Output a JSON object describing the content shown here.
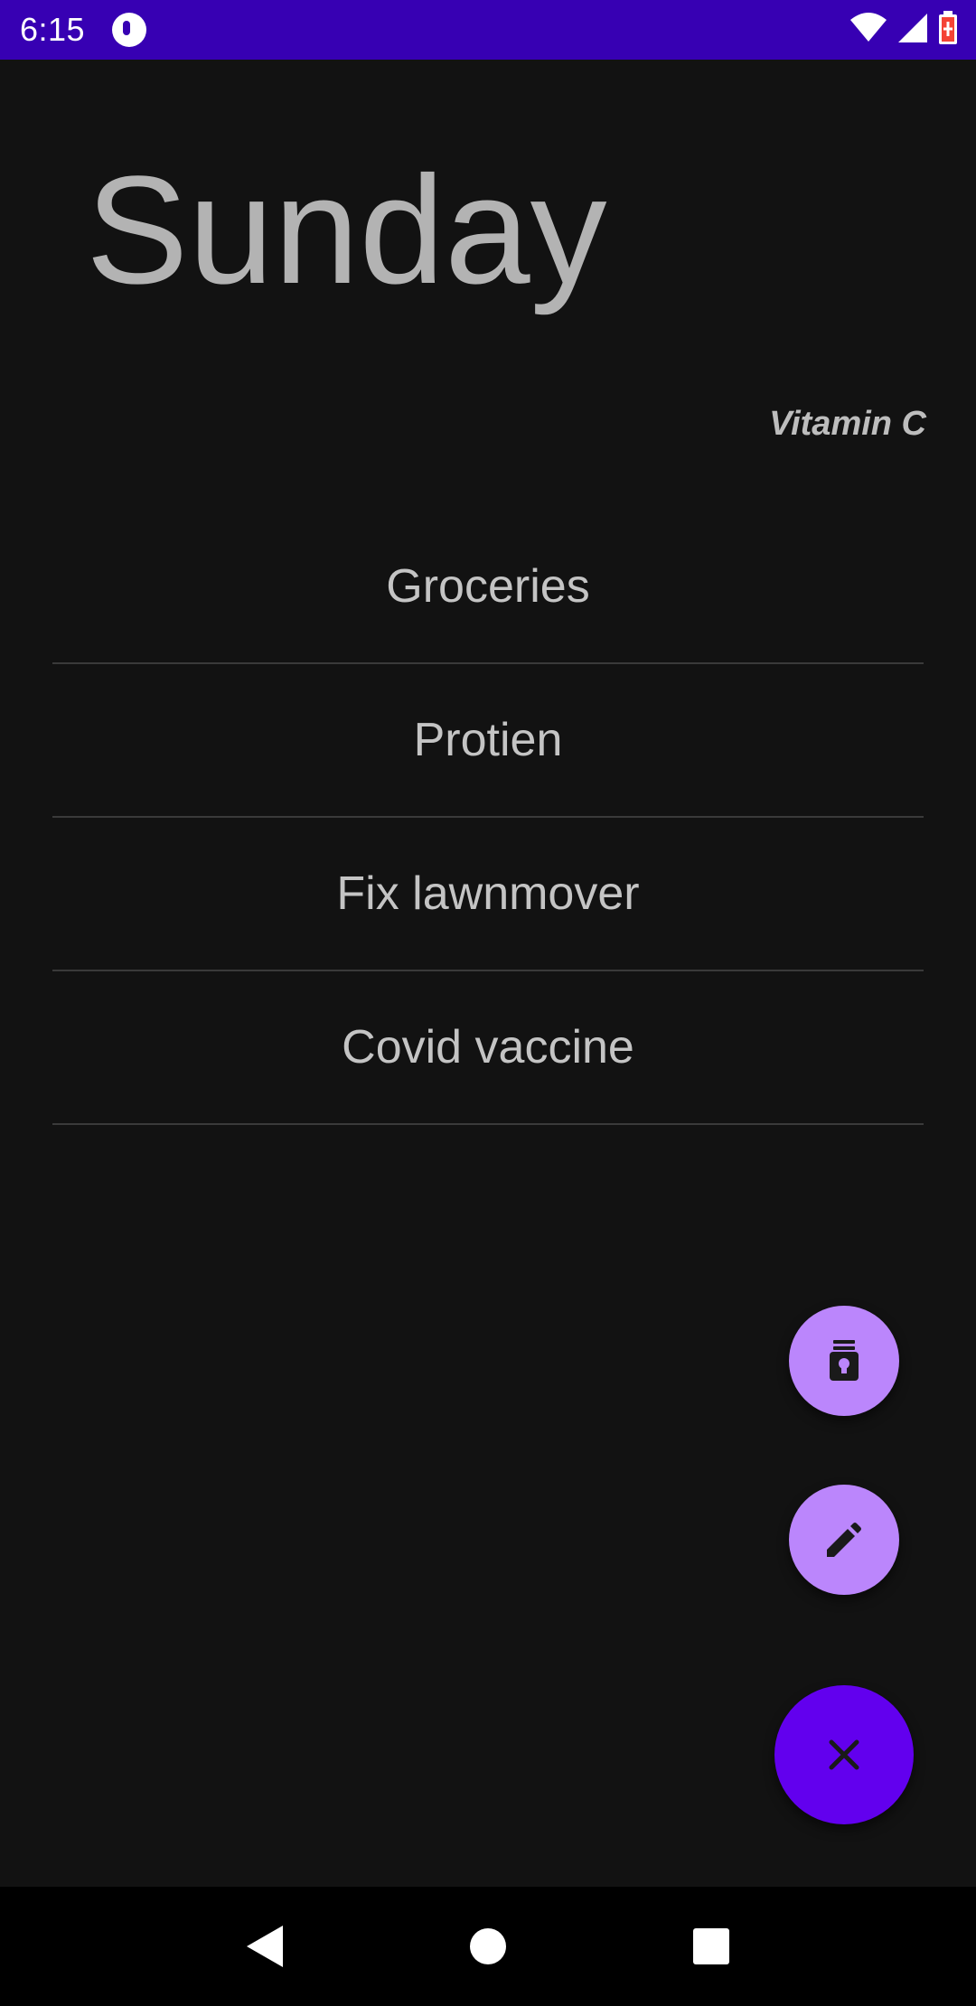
{
  "status_bar": {
    "time": "6:15",
    "icons": [
      "app-notification-icon",
      "wifi-icon",
      "signal-icon",
      "battery-icon"
    ]
  },
  "screen": {
    "title": "Sunday",
    "subtitle": "Vitamin C",
    "tasks": [
      {
        "label": "Groceries"
      },
      {
        "label": "Protien"
      },
      {
        "label": "Fix lawnmover"
      },
      {
        "label": "Covid vaccine"
      }
    ]
  },
  "fabs": {
    "reminder_icon": "lightbulb-jar-icon",
    "edit_icon": "pencil-icon",
    "close_icon": "close-icon"
  },
  "nav": {
    "back_icon": "back-triangle-icon",
    "home_icon": "home-circle-icon",
    "recents_icon": "recents-square-icon"
  },
  "colors": {
    "status_bar": "#3700b3",
    "background": "#121212",
    "fab_secondary": "#bb86fc",
    "fab_primary": "#6200ee"
  }
}
